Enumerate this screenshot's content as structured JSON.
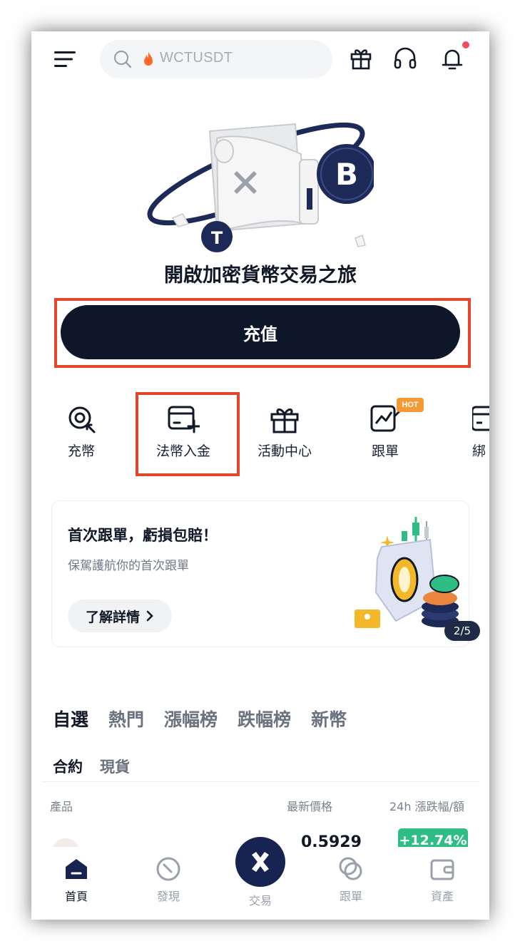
{
  "header": {
    "search_text": "WCTUSDT",
    "icons": [
      "menu-icon",
      "search-icon",
      "fire-icon",
      "gift-icon",
      "headset-icon",
      "bell-icon"
    ]
  },
  "hero": {
    "title": "開啟加密貨幣交易之旅",
    "deposit_label": "充值"
  },
  "quick_actions": [
    {
      "label": "充幣",
      "icon": "coin-deposit-icon"
    },
    {
      "label": "法幣入金",
      "icon": "card-plus-icon"
    },
    {
      "label": "活動中心",
      "icon": "gift-icon"
    },
    {
      "label": "跟單",
      "icon": "copy-trade-icon",
      "badge": "HOT"
    },
    {
      "label": "綁",
      "icon": "card-icon"
    }
  ],
  "promo": {
    "title": "首次跟單，虧損包賠！",
    "subtitle": "保駕護航你的首次跟單",
    "button": "了解詳情",
    "pager": "2/5"
  },
  "market": {
    "tabs": [
      "自選",
      "熱門",
      "漲幅榜",
      "跌幅榜",
      "新幣"
    ],
    "active_tab": "自選",
    "subtabs": [
      "合約",
      "現貨"
    ],
    "columns": {
      "product": "產品",
      "price": "最新價格",
      "change": "24h 漲跌幅/額"
    },
    "rows": [
      {
        "price": "0.5929",
        "change": "+12.74%"
      }
    ]
  },
  "bottom_nav": {
    "home": "首頁",
    "discover": "發現",
    "trade": "交易",
    "copy": "跟單",
    "assets": "資產"
  },
  "colors": {
    "primary_dark": "#0e1729",
    "highlight_red": "#e4452d",
    "positive_green": "#2ebd85",
    "hot_orange": "#f39a35",
    "trade_navy": "#172451"
  }
}
